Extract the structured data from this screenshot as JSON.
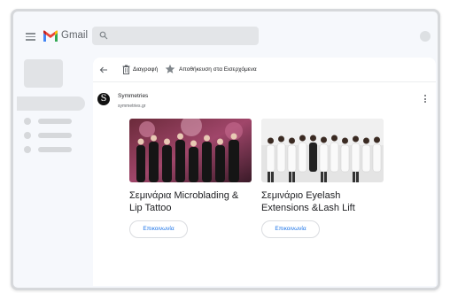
{
  "app": {
    "brand": "Gmail"
  },
  "toolbar": {
    "delete_label": "Διαγραφή",
    "archive_label": "Αποθήκευση στα Εισερχόμενα"
  },
  "message": {
    "sender_name": "Symmetries",
    "sender_email": "symmetries.gr",
    "avatar_letter": "S"
  },
  "cards": [
    {
      "title": "Σεμινάρια Microblading & Lip Tattoo",
      "button": "Επικοινωνία"
    },
    {
      "title": "Σεμινάριο Eyelash Extensions &Lash Lift",
      "button": "Επικοινωνία"
    }
  ],
  "colors": {
    "accent": "#1a73e8",
    "background": "#f6f8fc",
    "placeholder": "#e1e3e6"
  },
  "icons": [
    "hamburger-menu-icon",
    "gmail-logo-icon",
    "search-icon",
    "back-arrow-icon",
    "trash-icon",
    "star-icon",
    "more-vertical-icon"
  ]
}
